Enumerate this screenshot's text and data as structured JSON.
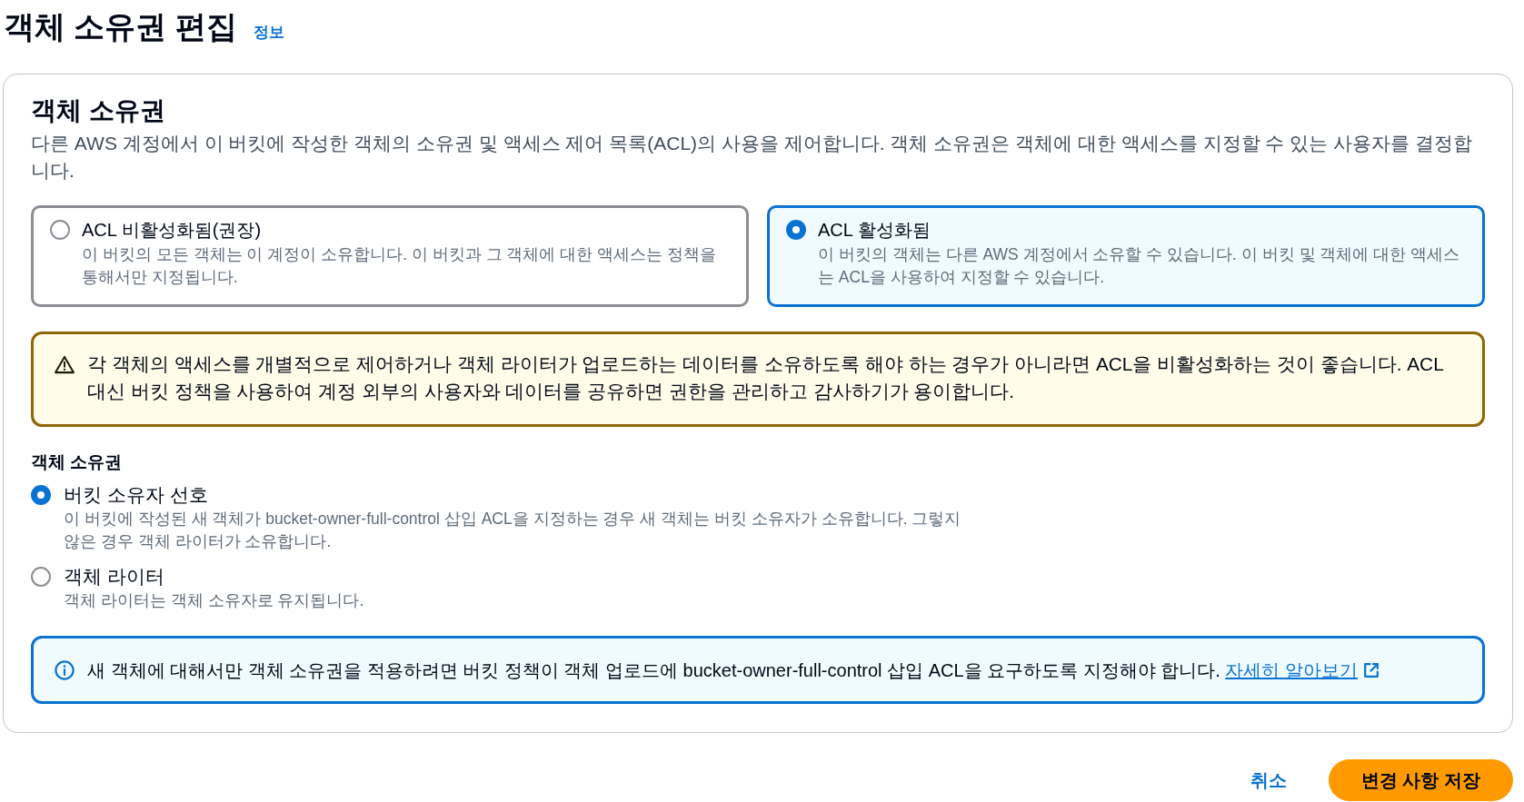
{
  "page": {
    "title": "객체 소유권 편집",
    "info_link": "정보"
  },
  "panel": {
    "heading": "객체 소유권",
    "description": "다른 AWS 계정에서 이 버킷에 작성한 객체의 소유권 및 액세스 제어 목록(ACL)의 사용을 제어합니다. 객체 소유권은 객체에 대한 액세스를 지정할 수 있는 사용자를 결정합니다.",
    "acl_options": [
      {
        "label": "ACL 비활성화됨(권장)",
        "description": "이 버킷의 모든 객체는 이 계정이 소유합니다. 이 버킷과 그 객체에 대한 액세스는 정책을 통해서만 지정됩니다.",
        "selected": false
      },
      {
        "label": "ACL 활성화됨",
        "description": "이 버킷의 객체는 다른 AWS 계정에서 소유할 수 있습니다. 이 버킷 및 객체에 대한 액세스는 ACL을 사용하여 지정할 수 있습니다.",
        "selected": true
      }
    ],
    "warning": {
      "text": "각 객체의 액세스를 개별적으로 제어하거나 객체 라이터가 업로드하는 데이터를 소유하도록 해야 하는 경우가 아니라면 ACL을 비활성화하는 것이 좋습니다. ACL 대신 버킷 정책을 사용하여 계정 외부의 사용자와 데이터를 공유하면 권한을 관리하고 감사하기가 용이합니다."
    },
    "ownership": {
      "label": "객체 소유권",
      "options": [
        {
          "label": "버킷 소유자 선호",
          "description": "이 버킷에 작성된 새 객체가 bucket-owner-full-control 삽입 ACL을 지정하는 경우 새 객체는 버킷 소유자가 소유합니다. 그렇지 않은 경우 객체 라이터가 소유합니다.",
          "selected": true
        },
        {
          "label": "객체 라이터",
          "description": "객체 라이터는 객체 소유자로 유지됩니다.",
          "selected": false
        }
      ]
    },
    "info": {
      "text": "새 객체에 대해서만 객체 소유권을 적용하려면 버킷 정책이 객체 업로드에 bucket-owner-full-control 삽입 ACL을 요구하도록 지정해야 합니다.",
      "link": "자세히 알아보기"
    }
  },
  "actions": {
    "cancel": "취소",
    "save": "변경 사항 저장"
  }
}
